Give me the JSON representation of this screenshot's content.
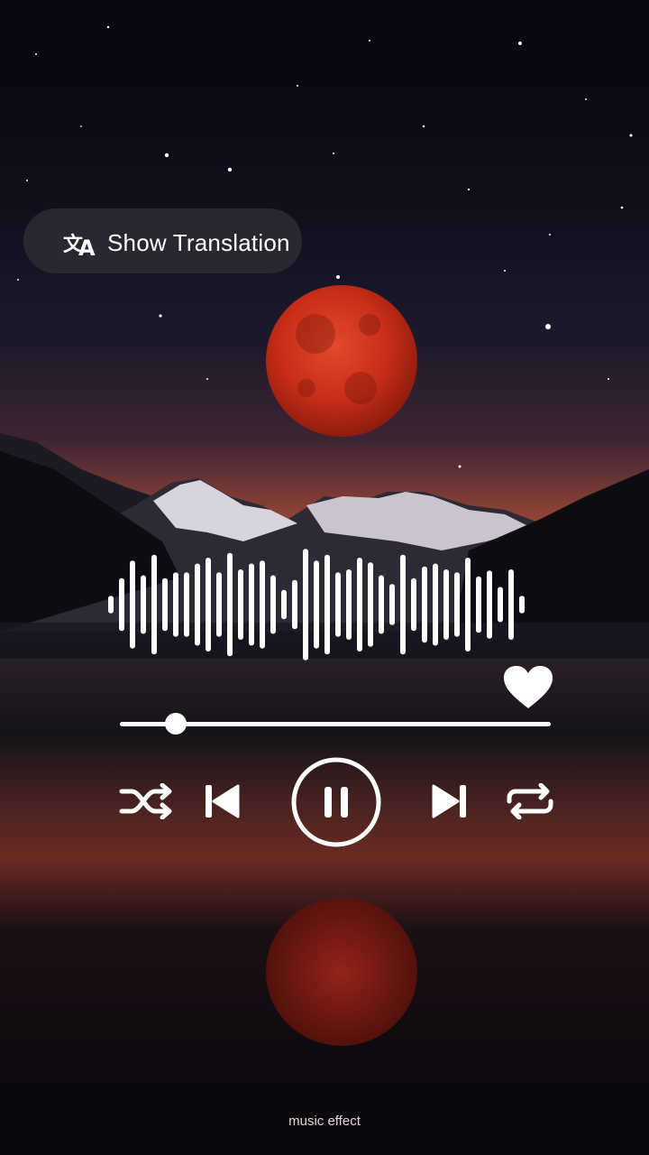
{
  "translation_button": {
    "label": "Show Translation",
    "icon": "translate-icon"
  },
  "player": {
    "liked": true,
    "progress": 0.13,
    "state": "playing",
    "controls": [
      "shuffle-icon",
      "previous-icon",
      "pause-icon",
      "next-icon",
      "repeat-icon"
    ],
    "waveform_levels": [
      0.15,
      0.45,
      0.75,
      0.5,
      0.85,
      0.45,
      0.55,
      0.55,
      0.7,
      0.8,
      0.55,
      0.88,
      0.6,
      0.7,
      0.75,
      0.5,
      0.25,
      0.42,
      0.95,
      0.75,
      0.85,
      0.55,
      0.6,
      0.8,
      0.72,
      0.5,
      0.35,
      0.85,
      0.45,
      0.65,
      0.7,
      0.6,
      0.55,
      0.8,
      0.48,
      0.58,
      0.3,
      0.6,
      0.15
    ]
  },
  "footer": {
    "caption": "music effect"
  },
  "colors": {
    "moon": "#d8321c",
    "sky_glow": "#b2523d",
    "controls": "#ffffff"
  }
}
